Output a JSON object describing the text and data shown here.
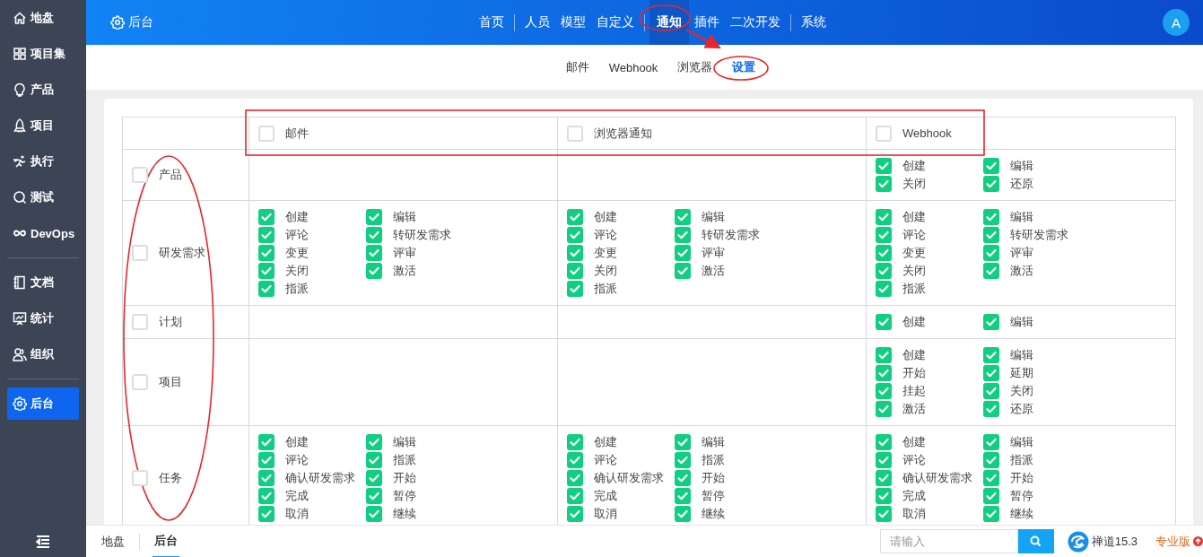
{
  "sidebar": {
    "items": [
      {
        "label": "地盘",
        "selected": false,
        "divider_after": false
      },
      {
        "label": "项目集",
        "selected": false,
        "divider_after": false
      },
      {
        "label": "产品",
        "selected": false,
        "divider_after": false
      },
      {
        "label": "项目",
        "selected": false,
        "divider_after": false
      },
      {
        "label": "执行",
        "selected": false,
        "divider_after": false
      },
      {
        "label": "测试",
        "selected": false,
        "divider_after": false
      },
      {
        "label": "DevOps",
        "selected": false,
        "divider_after": true
      },
      {
        "label": "文档",
        "selected": false,
        "divider_after": false
      },
      {
        "label": "统计",
        "selected": false,
        "divider_after": false
      },
      {
        "label": "组织",
        "selected": false,
        "divider_after": true
      },
      {
        "label": "后台",
        "selected": true,
        "divider_after": false
      }
    ]
  },
  "topbar": {
    "title": "后台",
    "avatar": "A",
    "nav": [
      {
        "label": "首页",
        "selected": false,
        "divider_after": true
      },
      {
        "label": "人员",
        "selected": false,
        "divider_after": false
      },
      {
        "label": "模型",
        "selected": false,
        "divider_after": false
      },
      {
        "label": "自定义",
        "selected": false,
        "divider_after": true
      },
      {
        "label": "通知",
        "selected": true,
        "divider_after": false
      },
      {
        "label": "插件",
        "selected": false,
        "divider_after": false
      },
      {
        "label": "二次开发",
        "selected": false,
        "divider_after": true
      },
      {
        "label": "系统",
        "selected": false,
        "divider_after": false
      }
    ]
  },
  "subnav": [
    {
      "label": "邮件",
      "selected": false
    },
    {
      "label": "Webhook",
      "selected": false
    },
    {
      "label": "浏览器",
      "selected": false
    },
    {
      "label": "设置",
      "selected": true
    }
  ],
  "table": {
    "columns": [
      {
        "label": "邮件",
        "checked": false
      },
      {
        "label": "浏览器通知",
        "checked": false
      },
      {
        "label": "Webhook",
        "checked": false
      }
    ],
    "rows": [
      {
        "label": "产品",
        "checked": false,
        "cells": [
          [],
          [],
          [
            {
              "label": "创建",
              "checked": true
            },
            {
              "label": "编辑",
              "checked": true
            },
            {
              "label": "关闭",
              "checked": true
            },
            {
              "label": "还原",
              "checked": true
            }
          ]
        ]
      },
      {
        "label": "研发需求",
        "checked": false,
        "cells": [
          [
            {
              "label": "创建",
              "checked": true
            },
            {
              "label": "编辑",
              "checked": true
            },
            {
              "label": "评论",
              "checked": true
            },
            {
              "label": "转研发需求",
              "checked": true
            },
            {
              "label": "变更",
              "checked": true
            },
            {
              "label": "评审",
              "checked": true
            },
            {
              "label": "关闭",
              "checked": true
            },
            {
              "label": "激活",
              "checked": true
            },
            {
              "label": "指派",
              "checked": true
            }
          ],
          [
            {
              "label": "创建",
              "checked": true
            },
            {
              "label": "编辑",
              "checked": true
            },
            {
              "label": "评论",
              "checked": true
            },
            {
              "label": "转研发需求",
              "checked": true
            },
            {
              "label": "变更",
              "checked": true
            },
            {
              "label": "评审",
              "checked": true
            },
            {
              "label": "关闭",
              "checked": true
            },
            {
              "label": "激活",
              "checked": true
            },
            {
              "label": "指派",
              "checked": true
            }
          ],
          [
            {
              "label": "创建",
              "checked": true
            },
            {
              "label": "编辑",
              "checked": true
            },
            {
              "label": "评论",
              "checked": true
            },
            {
              "label": "转研发需求",
              "checked": true
            },
            {
              "label": "变更",
              "checked": true
            },
            {
              "label": "评审",
              "checked": true
            },
            {
              "label": "关闭",
              "checked": true
            },
            {
              "label": "激活",
              "checked": true
            },
            {
              "label": "指派",
              "checked": true
            }
          ]
        ]
      },
      {
        "label": "计划",
        "checked": false,
        "cells": [
          [],
          [],
          [
            {
              "label": "创建",
              "checked": true
            },
            {
              "label": "编辑",
              "checked": true
            }
          ]
        ]
      },
      {
        "label": "项目",
        "checked": false,
        "cells": [
          [],
          [],
          [
            {
              "label": "创建",
              "checked": true
            },
            {
              "label": "编辑",
              "checked": true
            },
            {
              "label": "开始",
              "checked": true
            },
            {
              "label": "延期",
              "checked": true
            },
            {
              "label": "挂起",
              "checked": true
            },
            {
              "label": "关闭",
              "checked": true
            },
            {
              "label": "激活",
              "checked": true
            },
            {
              "label": "还原",
              "checked": true
            }
          ]
        ]
      },
      {
        "label": "任务",
        "checked": false,
        "cells": [
          [
            {
              "label": "创建",
              "checked": true
            },
            {
              "label": "编辑",
              "checked": true
            },
            {
              "label": "评论",
              "checked": true
            },
            {
              "label": "指派",
              "checked": true
            },
            {
              "label": "确认研发需求",
              "checked": true
            },
            {
              "label": "开始",
              "checked": true
            },
            {
              "label": "完成",
              "checked": true
            },
            {
              "label": "暂停",
              "checked": true
            },
            {
              "label": "取消",
              "checked": true
            },
            {
              "label": "继续",
              "checked": true
            }
          ],
          [
            {
              "label": "创建",
              "checked": true
            },
            {
              "label": "编辑",
              "checked": true
            },
            {
              "label": "评论",
              "checked": true
            },
            {
              "label": "指派",
              "checked": true
            },
            {
              "label": "确认研发需求",
              "checked": true
            },
            {
              "label": "开始",
              "checked": true
            },
            {
              "label": "完成",
              "checked": true
            },
            {
              "label": "暂停",
              "checked": true
            },
            {
              "label": "取消",
              "checked": true
            },
            {
              "label": "继续",
              "checked": true
            }
          ],
          [
            {
              "label": "创建",
              "checked": true
            },
            {
              "label": "编辑",
              "checked": true
            },
            {
              "label": "评论",
              "checked": true
            },
            {
              "label": "指派",
              "checked": true
            },
            {
              "label": "确认研发需求",
              "checked": true
            },
            {
              "label": "开始",
              "checked": true
            },
            {
              "label": "完成",
              "checked": true
            },
            {
              "label": "暂停",
              "checked": true
            },
            {
              "label": "取消",
              "checked": true
            },
            {
              "label": "继续",
              "checked": true
            }
          ]
        ]
      }
    ]
  },
  "footer": {
    "breadcrumbs": [
      {
        "label": "地盘",
        "selected": false
      },
      {
        "label": "后台",
        "selected": true
      }
    ],
    "search": {
      "placeholder": "请输入"
    },
    "version": "禅道15.3",
    "edition": "专业版"
  }
}
